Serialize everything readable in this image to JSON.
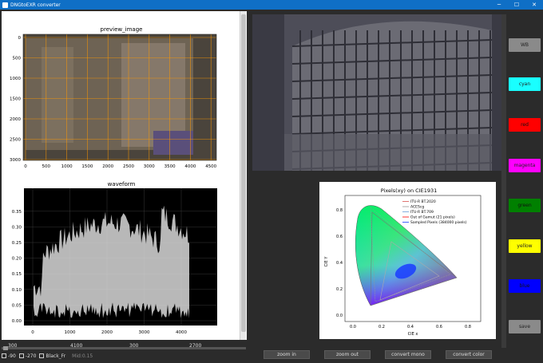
{
  "window": {
    "title": "DNGtoEXR converter"
  },
  "window_controls": {
    "minimize": "─",
    "maximize": "☐",
    "close": "✕"
  },
  "preview": {
    "title": "preview_image",
    "y_ticks": [
      "0",
      "500",
      "1000",
      "1500",
      "2000",
      "2500",
      "3000"
    ],
    "x_ticks": [
      "0",
      "500",
      "1000",
      "1500",
      "2000",
      "2500",
      "3000",
      "3500",
      "4000",
      "4500"
    ]
  },
  "waveform": {
    "title": "waveform",
    "y_ticks": [
      "0.00",
      "0.05",
      "0.10",
      "0.15",
      "0.20",
      "0.25",
      "0.30",
      "0.35"
    ],
    "x_ticks": [
      "0",
      "1000",
      "2000",
      "3000",
      "4000"
    ]
  },
  "slider_labels": [
    "300",
    "4100",
    "300",
    "2700"
  ],
  "checkboxes": [
    {
      "label": "-90"
    },
    {
      "label": "-270"
    },
    {
      "label": "Black_Fr"
    }
  ],
  "status_text": "Mid:0.15",
  "cie": {
    "title": "Pixels(xy) on CIE1931",
    "xlabel": "CIE x",
    "ylabel": "CIE Y",
    "legend": [
      "ITU-R BT.2020",
      "ACEScg",
      "ITU-R BT.709",
      "Out of Gamut (21 pixels)",
      "Sampled Pixels (384000 pixels)"
    ],
    "x_ticks": [
      "0.0",
      "0.2",
      "0.4",
      "0.6",
      "0.8"
    ],
    "y_ticks": [
      "0.0",
      "0.2",
      "0.4",
      "0.6",
      "0.8"
    ]
  },
  "bottom_buttons": [
    "zoom in",
    "zoom out",
    "convert mono",
    "convert color"
  ],
  "side_buttons": [
    {
      "label": "WB",
      "color": "#8a8a8a"
    },
    {
      "label": "cyan",
      "color": "#19ffff"
    },
    {
      "label": "red",
      "color": "#ff0000"
    },
    {
      "label": "magenta",
      "color": "#ff00ff"
    },
    {
      "label": "green",
      "color": "#008000"
    },
    {
      "label": "yellow",
      "color": "#ffff00"
    },
    {
      "label": "blue",
      "color": "#0000ff"
    },
    {
      "label": "save",
      "color": "#8a8a8a"
    }
  ],
  "theme": {
    "titlebar": "#0f6fc6",
    "dark_bg": "#2b2b2b",
    "grid_line": "#ff9900"
  }
}
